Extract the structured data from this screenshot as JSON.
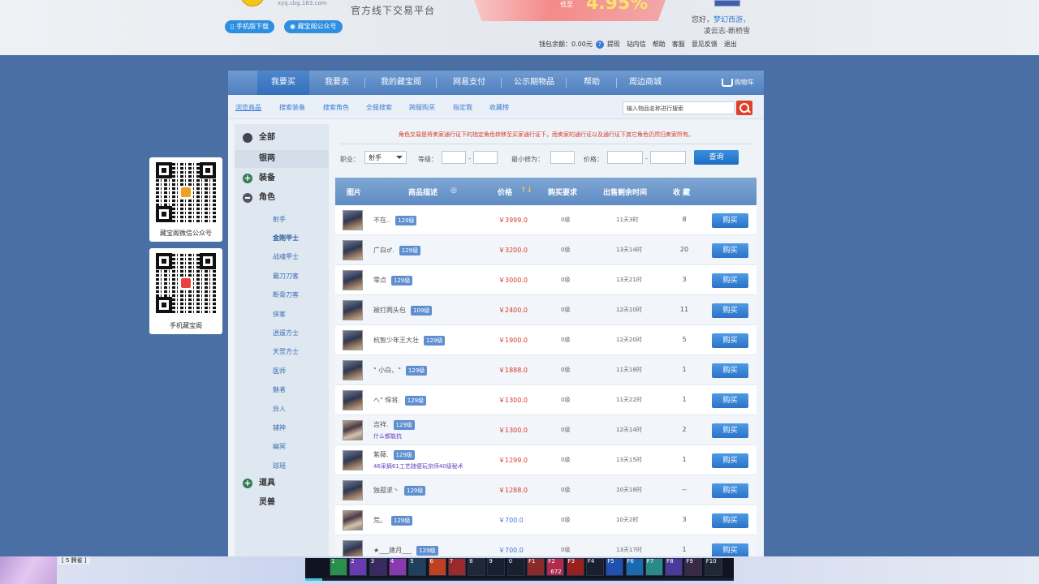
{
  "header": {
    "logo_url": "xyq.cbg.163.com",
    "slogan": "官方线下交易平台",
    "promo_prefix": "低至",
    "promo_value": "4.95%",
    "mobile_download": "手机版下载",
    "wechat_account": "藏宝阁公众号",
    "hello": "您好，",
    "hello_link": "梦幻西游，",
    "user_name": "凌云志-断桥雪",
    "wallet_label": "钱包余额：",
    "wallet_amount": "0.00元",
    "wallet_help": "?",
    "links": [
      "提现",
      "站内信",
      "帮助",
      "客服",
      "意见反馈",
      "退出"
    ]
  },
  "side_cards": [
    {
      "label": "藏宝阁微信公众号"
    },
    {
      "label": "手机藏宝阁"
    }
  ],
  "nav": {
    "items": [
      "我要买",
      "我要卖",
      "我的藏宝阁",
      "网易支付",
      "公示期物品",
      "帮助",
      "周边商城"
    ],
    "cart": "购物车"
  },
  "subnav": {
    "items": [
      "浏览商品",
      "搜索装备",
      "搜索角色",
      "全服搜索",
      "跨服购买",
      "指定我",
      "收藏榜"
    ],
    "search_placeholder": "输入物品名称进行搜索"
  },
  "categories": {
    "all": "全部",
    "money": "银两",
    "equipment": "装备",
    "character": "角色",
    "roles": [
      "射手",
      "金刚甲士",
      "战魂甲士",
      "霸刀刀客",
      "断骨刀客",
      "侠客",
      "逍遥方士",
      "天罡方士",
      "医师",
      "魅者",
      "异人",
      "辅神",
      "幽冥",
      "琼瑶"
    ],
    "items": "道具",
    "pets": "灵兽"
  },
  "filter": {
    "notice": "角色交易是将卖家通行证下的指定角色转移至买家通行证下，而卖家的通行证以及通行证下其它角色仍然归卖家所有。",
    "job_label": "职业：",
    "job_value": "射手",
    "level_label": "等级：",
    "min_power_label": "最小修为：",
    "price_label": "价格：",
    "dash": "-",
    "query": "查询"
  },
  "table": {
    "headers": [
      "图片",
      "商品描述",
      "价格",
      "购买要求",
      "出售剩余时间",
      "收 藏"
    ],
    "buy_label": "购买",
    "rows": [
      {
        "name": "不在..",
        "level": "129级",
        "sub": "",
        "price": "￥3999.0",
        "req": "0级",
        "time": "11天3时",
        "fav": "8",
        "female": false
      },
      {
        "name": "广白♂.",
        "level": "129级",
        "sub": "",
        "price": "￥3200.0",
        "req": "0级",
        "time": "13天14时",
        "fav": "20",
        "female": false
      },
      {
        "name": "零点",
        "level": "129级",
        "sub": "",
        "price": "￥3000.0",
        "req": "0级",
        "time": "13天21时",
        "fav": "3",
        "female": false
      },
      {
        "name": "被打两头包",
        "level": "109级",
        "sub": "",
        "price": "￥2400.0",
        "req": "0级",
        "time": "12天10时",
        "fav": "11",
        "female": false
      },
      {
        "name": "杭智少年王大壮",
        "level": "129级",
        "sub": "",
        "price": "￥1900.0",
        "req": "0级",
        "time": "12天20时",
        "fav": "5",
        "female": false
      },
      {
        "name": "\" 小白、\"",
        "level": "129级",
        "sub": "",
        "price": "￥1888.0",
        "req": "0级",
        "time": "11天18时",
        "fav": "1",
        "female": false
      },
      {
        "name": "ヘ\" 悍将.",
        "level": "129级",
        "sub": "",
        "price": "￥1300.0",
        "req": "0级",
        "time": "11天22时",
        "fav": "1",
        "female": false
      },
      {
        "name": "吉祥.",
        "level": "129级",
        "sub": "什么都能抗",
        "price": "￥1300.0",
        "req": "0级",
        "time": "12天14时",
        "fav": "2",
        "female": true
      },
      {
        "name": "紫薇.",
        "level": "129级",
        "sub": "46采摘61工艺随便玩京师40级秘术",
        "price": "￥1299.0",
        "req": "0级",
        "time": "13天15时",
        "fav": "1",
        "female": false
      },
      {
        "name": "独孤求丶",
        "level": "129级",
        "sub": "",
        "price": "￥1288.0",
        "req": "0级",
        "time": "10天18时",
        "fav": "--",
        "female": false
      },
      {
        "name": "荒。",
        "level": "129级",
        "sub": "",
        "price": "￥700.0",
        "req": "0级",
        "time": "10天2时",
        "fav": "3",
        "female": true
      },
      {
        "name": "★___建月___",
        "level": "129级",
        "sub": "",
        "price": "￥700.0",
        "req": "0级",
        "time": "13天17时",
        "fav": "1",
        "female": false
      }
    ]
  },
  "taskbar": {
    "label": "[ 5 腾雀 ]",
    "skill_keys": [
      "1",
      "2",
      "3",
      "4",
      "5",
      "6",
      "7",
      "8",
      "9",
      "0",
      "F1",
      "F2",
      "F3",
      "F4",
      "F5",
      "F6",
      "F7",
      "F8",
      "F9",
      "F10"
    ],
    "skill_colors": [
      "#2a8f4a",
      "#6a3ab0",
      "#3a2a60",
      "#8a3ab0",
      "#204060",
      "#c04020",
      "#9a2a2a",
      "#202838",
      "#1a2030",
      "#1a2030",
      "#8a2a2a",
      "#b02a4a",
      "#9a2020",
      "#1a2030",
      "#2050b0",
      "#1a6ab0",
      "#2a8a8a",
      "#4a3a9a",
      "#3a2a4a",
      "#202838"
    ],
    "skill_count_badge": "672",
    "progress": 0.04
  }
}
